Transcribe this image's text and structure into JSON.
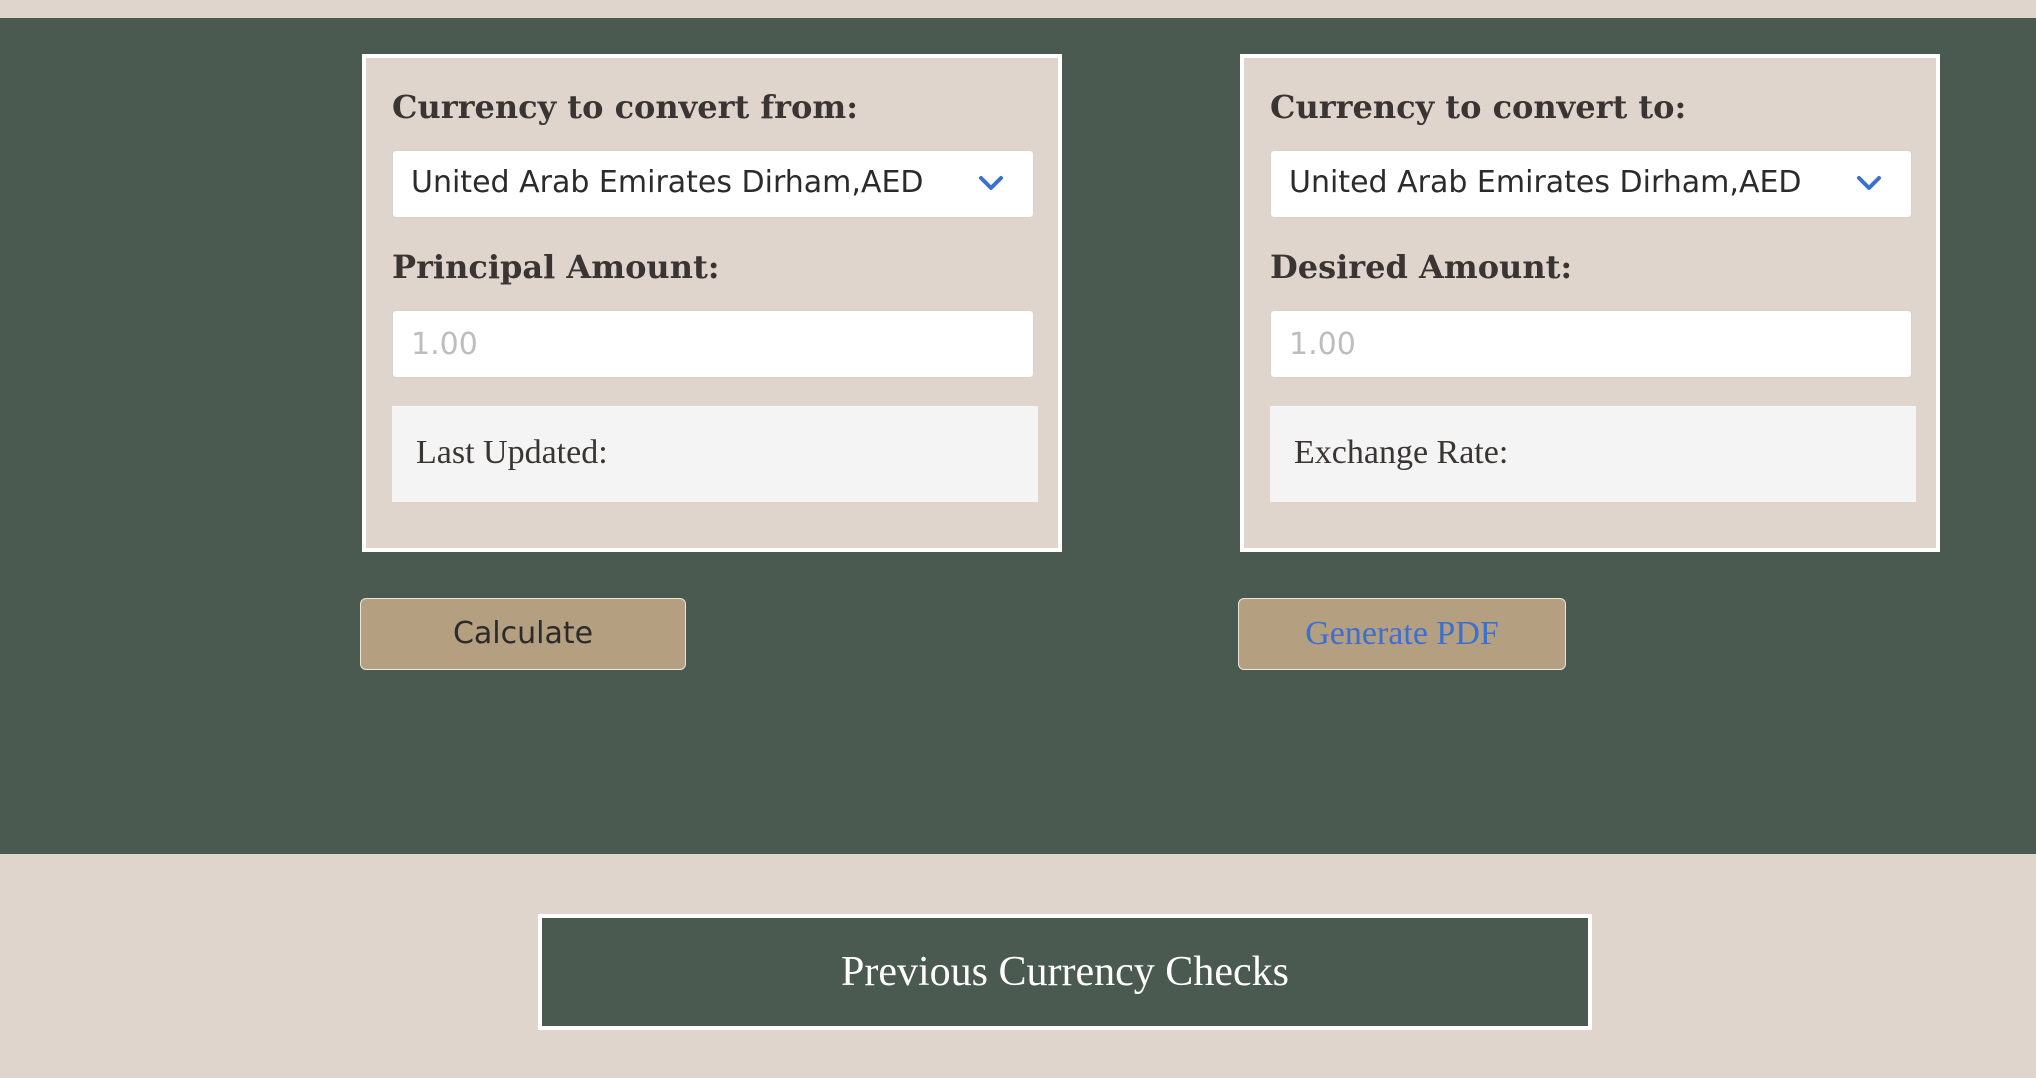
{
  "from_panel": {
    "currency_label": "Currency to convert from:",
    "selected_currency": "United Arab Emirates Dirham,AED",
    "amount_label": "Principal Amount:",
    "amount_placeholder": "1.00",
    "info_text": "Last Updated:"
  },
  "to_panel": {
    "currency_label": "Currency to convert to:",
    "selected_currency": "United Arab Emirates Dirham,AED",
    "amount_label": "Desired Amount:",
    "amount_placeholder": "1.00",
    "info_text": "Exchange Rate:"
  },
  "actions": {
    "calculate_label": "Calculate",
    "pdf_label": "Generate PDF"
  },
  "history": {
    "label": "Previous Currency Checks"
  },
  "icons": {
    "dropdown": "chevron-down-icon"
  },
  "colors": {
    "green": "#4a5a50",
    "beige": "#dfd5cd",
    "button": "#b59f81",
    "link_blue": "#3b6fd0",
    "chevron_blue": "#3b6fd0"
  }
}
